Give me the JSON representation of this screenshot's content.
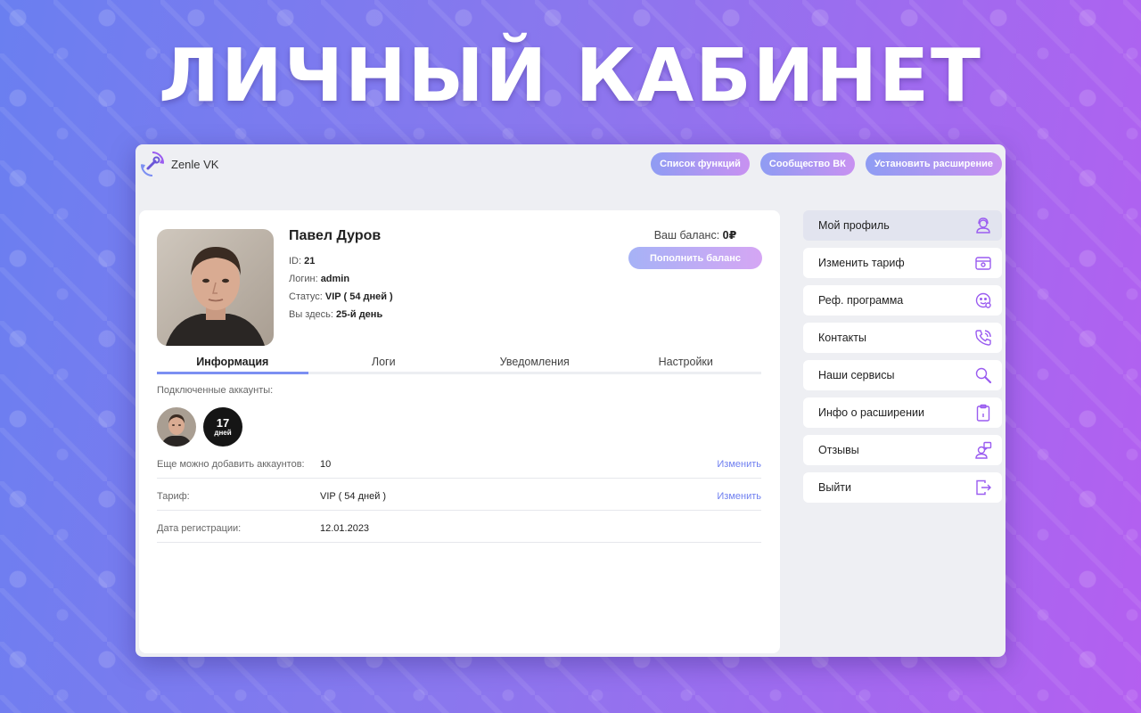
{
  "hero": {
    "title": "ЛИЧНЫЙ КАБИНЕТ"
  },
  "app": {
    "name": "Zenle VK",
    "logo_icon": "wrench-cycle-icon"
  },
  "topbar": {
    "buttons": [
      "Список функций",
      "Сообщество ВК",
      "Установить расширение"
    ]
  },
  "profile": {
    "name": "Павел Дуров",
    "id_label": "ID: ",
    "id_value": "21",
    "login_label": "Логин: ",
    "login_value": "admin",
    "status_label": "Статус: ",
    "status_value": "VIP ( 54 дней )",
    "here_label": "Вы здесь: ",
    "here_value": "25-й день"
  },
  "balance": {
    "label": "Ваш баланс: ",
    "value": "0₽",
    "topup_label": "Пополнить баланс"
  },
  "tabs": [
    {
      "label": "Информация",
      "active": true
    },
    {
      "label": "Логи",
      "active": false
    },
    {
      "label": "Уведомления",
      "active": false
    },
    {
      "label": "Настройки",
      "active": false
    }
  ],
  "accounts": {
    "label": "Подключенные аккаунты:",
    "days_num": "17",
    "days_word": "дней"
  },
  "details": [
    {
      "label": "Еще можно добавить аккаунтов:",
      "value": "10",
      "link": "Изменить"
    },
    {
      "label": "Тариф:",
      "value": "VIP ( 54 дней )",
      "link": "Изменить"
    },
    {
      "label": "Дата регистрации:",
      "value": "12.01.2023",
      "link": ""
    }
  ],
  "sidebar": {
    "items": [
      {
        "label": "Мой профиль",
        "icon": "user-support-icon",
        "active": true
      },
      {
        "label": "Изменить тариф",
        "icon": "tariff-box-icon",
        "active": false
      },
      {
        "label": "Реф. программа",
        "icon": "referral-face-icon",
        "active": false
      },
      {
        "label": "Контакты",
        "icon": "phone-icon",
        "active": false
      },
      {
        "label": "Наши сервисы",
        "icon": "search-icon",
        "active": false
      },
      {
        "label": "Инфо о расширении",
        "icon": "clipboard-info-icon",
        "active": false
      },
      {
        "label": "Отзывы",
        "icon": "review-user-icon",
        "active": false
      },
      {
        "label": "Выйти",
        "icon": "logout-icon",
        "active": false
      }
    ]
  },
  "colors": {
    "accent": "#7c8ff2",
    "link": "#6f7ff0",
    "icon": "#9a5cf0",
    "pill_start": "#8f9cf3",
    "pill_end": "#c891f1"
  }
}
